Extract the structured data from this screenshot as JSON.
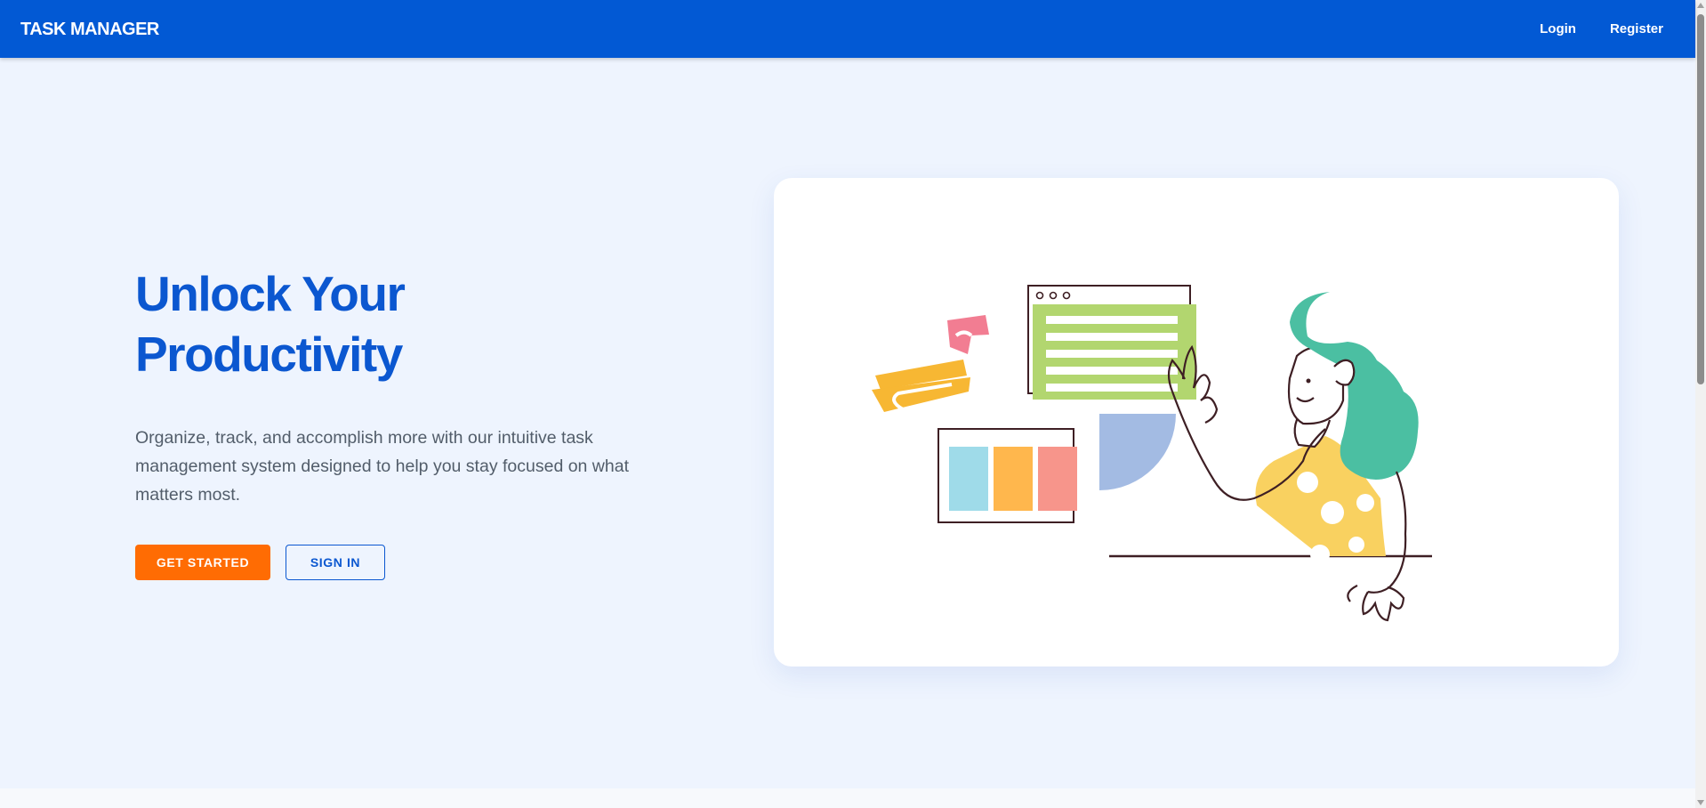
{
  "navbar": {
    "brand": "TASK MANAGER",
    "links": [
      "Login",
      "Register"
    ]
  },
  "hero": {
    "title_line1": "Unlock Your",
    "title_line2": "Productivity",
    "description": "Organize, track, and accomplish more with our intuitive task management system designed to help you stay focused on what matters most.",
    "primary_button": "GET STARTED",
    "secondary_button": "SIGN IN"
  },
  "colors": {
    "navbar": "#0259d4",
    "accent_blue": "#0b57d0",
    "accent_orange": "#ff6c03",
    "page_background": "#eef4fe"
  },
  "illustration": {
    "subject": "woman-waving-with-task-boards-illustration"
  }
}
